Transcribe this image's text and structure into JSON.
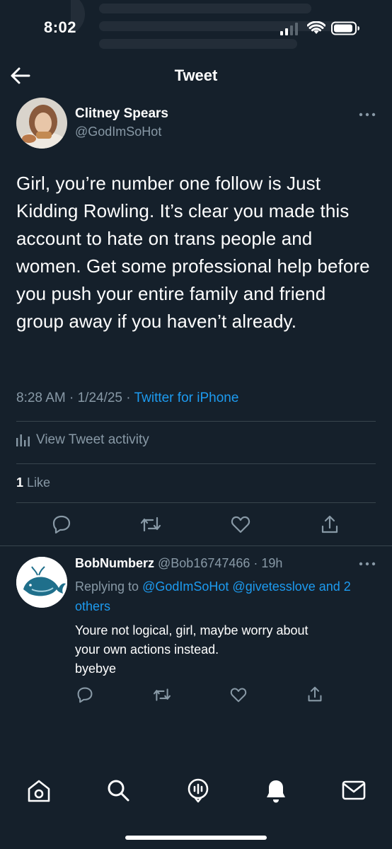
{
  "status_bar": {
    "time": "8:02"
  },
  "header": {
    "title": "Tweet",
    "back_icon": "arrow-left-icon"
  },
  "tweet": {
    "author_name": "Clitney Spears",
    "author_handle": "@GodImSoHot",
    "text": "Girl, you’re number one follow is Just Kidding Rowling. It’s clear you made this account to hate on trans people and women. Get some professional help before you push your entire family and friend group away if you haven’t already.",
    "time": "8:28 AM",
    "date": "1/24/25",
    "source": "Twitter for iPhone",
    "activity_label": "View Tweet activity",
    "like_count": "1",
    "like_label": "Like"
  },
  "reply": {
    "author_name": "BobNumberz",
    "author_handle": "@Bob16747466",
    "age": "19h",
    "replying_prefix": "Replying to",
    "replying_handle_1": "@GodImSoHot",
    "replying_handle_2": "@givetesslove",
    "replying_others": "and 2 others",
    "text": "Youre not logical, girl, maybe worry about\nyour own actions instead.\nbyebye"
  },
  "colors": {
    "background": "#15202b",
    "accent": "#1d9bf0",
    "secondary_text": "#8899a6",
    "divider": "#38444d"
  },
  "bottom_nav": {
    "items": [
      "home-icon",
      "search-icon",
      "spaces-icon",
      "notifications-icon",
      "messages-icon"
    ]
  }
}
